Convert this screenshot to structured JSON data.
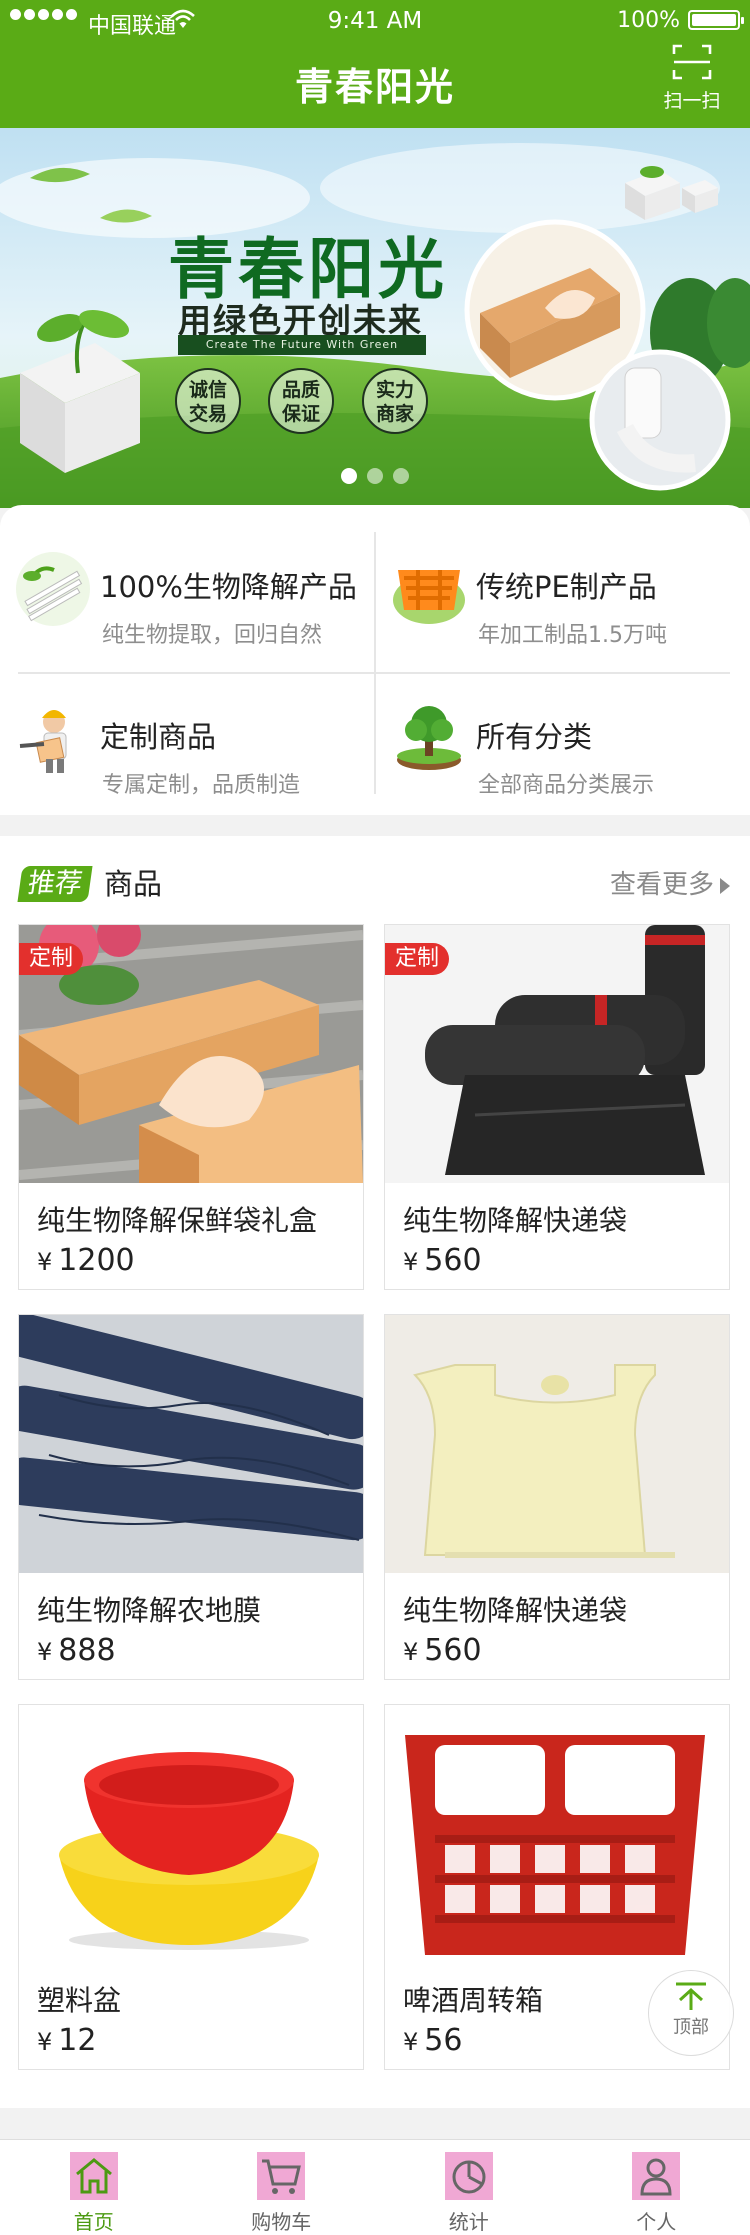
{
  "status_bar": {
    "carrier": "中国联通",
    "time": "9:41 AM",
    "battery": "100%"
  },
  "header": {
    "title": "青春阳光",
    "scan_label": "扫一扫"
  },
  "banner": {
    "headline": "青春阳光",
    "subheadline": "用绿色开创未来",
    "english": "Create The Future With Green",
    "badges": [
      {
        "line1": "诚信",
        "line2": "交易"
      },
      {
        "line1": "品质",
        "line2": "保证"
      },
      {
        "line1": "实力",
        "line2": "商家"
      }
    ],
    "slide_count": 3,
    "active_slide": 1
  },
  "categories": [
    {
      "title": "100%生物降解产品",
      "desc": "纯生物提取，回归自然",
      "icon": "biodegradable-straws-icon"
    },
    {
      "title": "传统PE制产品",
      "desc": "年加工制品1.5万吨",
      "icon": "plastic-crate-icon"
    },
    {
      "title": "定制商品",
      "desc": "专属定制，品质制造",
      "icon": "custom-worker-icon"
    },
    {
      "title": "所有分类",
      "desc": "全部商品分类展示",
      "icon": "tree-icon"
    }
  ],
  "recommended": {
    "tag": "推荐",
    "title": "商品",
    "more": "查看更多",
    "products": [
      {
        "name": "纯生物降解保鲜袋礼盒",
        "currency": "¥",
        "price": "1200",
        "tag": "定制"
      },
      {
        "name": "纯生物降解快递袋",
        "currency": "¥",
        "price": "560",
        "tag": "定制"
      },
      {
        "name": "纯生物降解农地膜",
        "currency": "¥",
        "price": "888",
        "tag": ""
      },
      {
        "name": "纯生物降解快递袋",
        "currency": "¥",
        "price": "560",
        "tag": ""
      },
      {
        "name": "塑料盆",
        "currency": "¥",
        "price": "12",
        "tag": ""
      },
      {
        "name": "啤酒周转箱",
        "currency": "¥",
        "price": "56",
        "tag": ""
      }
    ]
  },
  "back_to_top": "顶部",
  "tabbar": [
    {
      "label": "首页",
      "icon": "home-icon",
      "active": true
    },
    {
      "label": "购物车",
      "icon": "cart-icon",
      "active": false
    },
    {
      "label": "统计",
      "icon": "pie-chart-icon",
      "active": false
    },
    {
      "label": "个人",
      "icon": "user-icon",
      "active": false
    }
  ],
  "colors": {
    "brand_green": "#5aab16",
    "custom_tag_red": "#e3302d",
    "tab_icon_placeholder": "#f0a8d4"
  }
}
